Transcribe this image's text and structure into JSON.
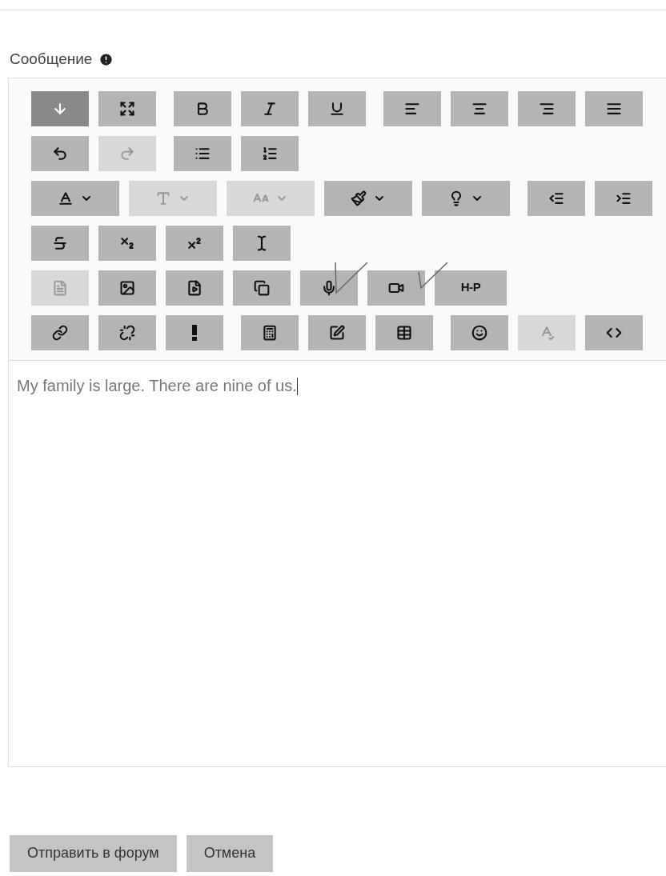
{
  "label": "Сообщение",
  "toolbar": [
    [
      [
        {
          "kind": "toggle",
          "pressed": true,
          "disabled": false
        },
        {
          "kind": "fullscreen",
          "pressed": false,
          "disabled": false
        }
      ],
      [
        {
          "kind": "bold",
          "pressed": false,
          "disabled": false
        },
        {
          "kind": "italic",
          "pressed": false,
          "disabled": false
        },
        {
          "kind": "underline",
          "pressed": false,
          "disabled": false
        }
      ],
      [
        {
          "kind": "align-left",
          "pressed": false,
          "disabled": false
        },
        {
          "kind": "align-center",
          "pressed": false,
          "disabled": false
        },
        {
          "kind": "align-right",
          "pressed": false,
          "disabled": false
        },
        {
          "kind": "align-justify",
          "pressed": false,
          "disabled": false
        }
      ]
    ],
    [
      [
        {
          "kind": "undo",
          "pressed": false,
          "disabled": false
        },
        {
          "kind": "redo",
          "pressed": false,
          "disabled": true
        }
      ],
      [
        {
          "kind": "bullet-list",
          "pressed": false,
          "disabled": false
        },
        {
          "kind": "numbered-list",
          "pressed": false,
          "disabled": false
        }
      ]
    ],
    [
      [
        {
          "kind": "font-color",
          "menu": true,
          "pressed": false,
          "disabled": false
        },
        {
          "kind": "font-family",
          "menu": true,
          "pressed": false,
          "disabled": true
        },
        {
          "kind": "font-size",
          "menu": true,
          "pressed": false,
          "disabled": true
        },
        {
          "kind": "brush",
          "menu": true,
          "pressed": false,
          "disabled": false
        },
        {
          "kind": "lightbulb",
          "menu": true,
          "pressed": false,
          "disabled": false
        }
      ],
      [
        {
          "kind": "outdent",
          "pressed": false,
          "disabled": false
        },
        {
          "kind": "indent",
          "pressed": false,
          "disabled": false
        }
      ]
    ],
    [
      [
        {
          "kind": "strikethrough",
          "pressed": false,
          "disabled": false
        },
        {
          "kind": "subscript",
          "pressed": false,
          "disabled": false
        },
        {
          "kind": "superscript",
          "pressed": false,
          "disabled": false
        },
        {
          "kind": "cursor",
          "pressed": false,
          "disabled": false
        }
      ]
    ],
    [
      [
        {
          "kind": "word",
          "pressed": false,
          "disabled": true
        },
        {
          "kind": "image",
          "pressed": false,
          "disabled": false
        },
        {
          "kind": "media",
          "pressed": false,
          "disabled": false
        },
        {
          "kind": "copy",
          "pressed": false,
          "disabled": false
        },
        {
          "kind": "mic",
          "pressed": false,
          "disabled": false
        },
        {
          "kind": "video",
          "pressed": false,
          "disabled": false
        },
        {
          "kind": "h5p",
          "label": "H-P",
          "pressed": false,
          "disabled": false
        }
      ]
    ],
    [
      [
        {
          "kind": "link",
          "pressed": false,
          "disabled": false
        },
        {
          "kind": "unlink",
          "pressed": false,
          "disabled": false
        },
        {
          "kind": "exclamation",
          "pressed": false,
          "disabled": false
        }
      ],
      [
        {
          "kind": "calculator",
          "pressed": false,
          "disabled": false
        },
        {
          "kind": "edit",
          "pressed": false,
          "disabled": false
        },
        {
          "kind": "table",
          "pressed": false,
          "disabled": false
        }
      ],
      [
        {
          "kind": "emoji",
          "pressed": false,
          "disabled": false
        },
        {
          "kind": "spellcheck",
          "pressed": false,
          "disabled": true
        },
        {
          "kind": "code",
          "pressed": false,
          "disabled": false
        }
      ]
    ]
  ],
  "content": "My family is large. There are nine of us.",
  "buttons": [
    "Отправить в форум",
    "Отмена"
  ]
}
